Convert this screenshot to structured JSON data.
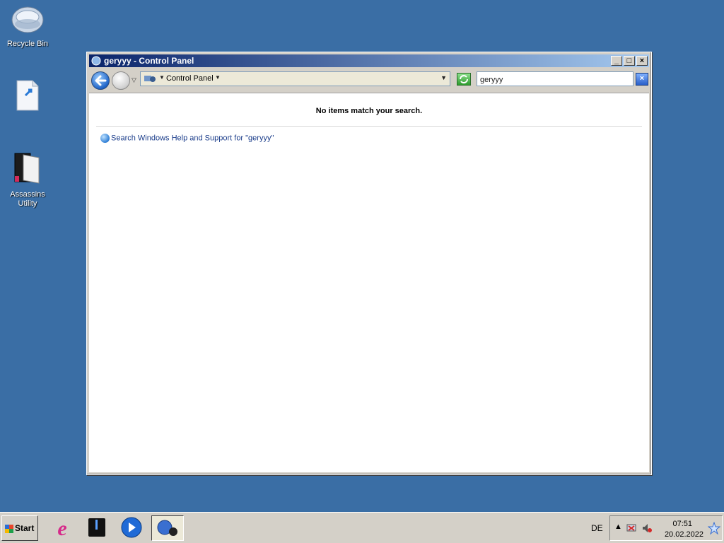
{
  "desktop": {
    "icons": [
      {
        "label": "Recycle Bin"
      },
      {
        "label": ""
      },
      {
        "label": "Assassins Utility"
      }
    ]
  },
  "window": {
    "title": "geryyy - Control Panel",
    "address": {
      "path": "Control Panel"
    },
    "search": {
      "value": "geryyy"
    },
    "content": {
      "no_items_text": "No items match your search.",
      "help_link_text": "Search Windows Help and Support for \"geryyy\""
    }
  },
  "taskbar": {
    "start_label": "Start",
    "apps": [
      {
        "name": "internet-explorer",
        "active": false
      },
      {
        "name": "flash-drive",
        "active": false
      },
      {
        "name": "media-player",
        "active": false
      },
      {
        "name": "control-panel",
        "active": true
      }
    ],
    "language": "DE",
    "clock": {
      "time": "07:51",
      "date": "20.02.2022"
    }
  },
  "colors": {
    "desktop_bg": "#3a6ea5",
    "title_bar_start": "#0a246a",
    "title_bar_end": "#a6caf0",
    "link": "#1a3c8a"
  }
}
